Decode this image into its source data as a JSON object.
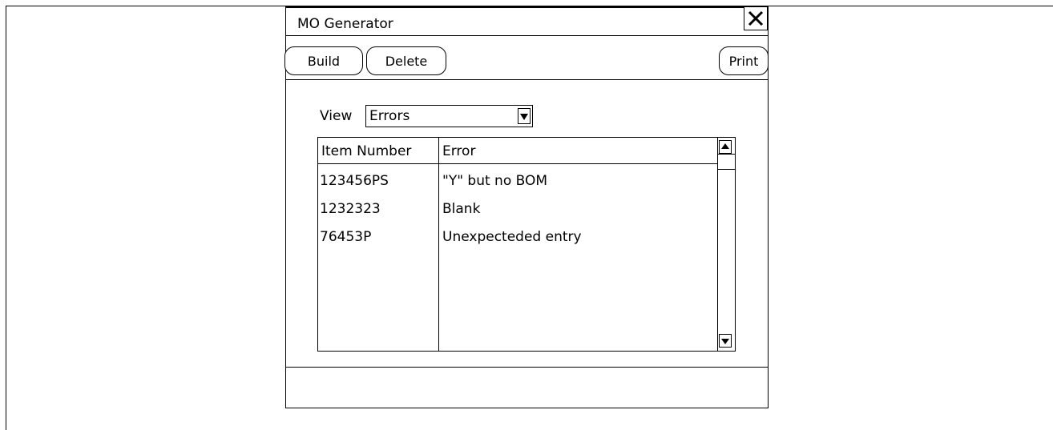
{
  "window": {
    "title": "MO Generator",
    "close_icon": "close-icon"
  },
  "toolbar": {
    "build_label": "Build",
    "delete_label": "Delete",
    "print_label": "Print"
  },
  "view": {
    "label": "View",
    "selected": "Errors",
    "dropdown_icon": "triangle-down-icon"
  },
  "table": {
    "columns": [
      "Item Number",
      "Error"
    ],
    "rows": [
      {
        "item_number": "123456PS",
        "error": "\"Y\" but no BOM"
      },
      {
        "item_number": "1232323",
        "error": "Blank"
      },
      {
        "item_number": "76453P",
        "error": "Unexpecteded entry"
      }
    ]
  }
}
